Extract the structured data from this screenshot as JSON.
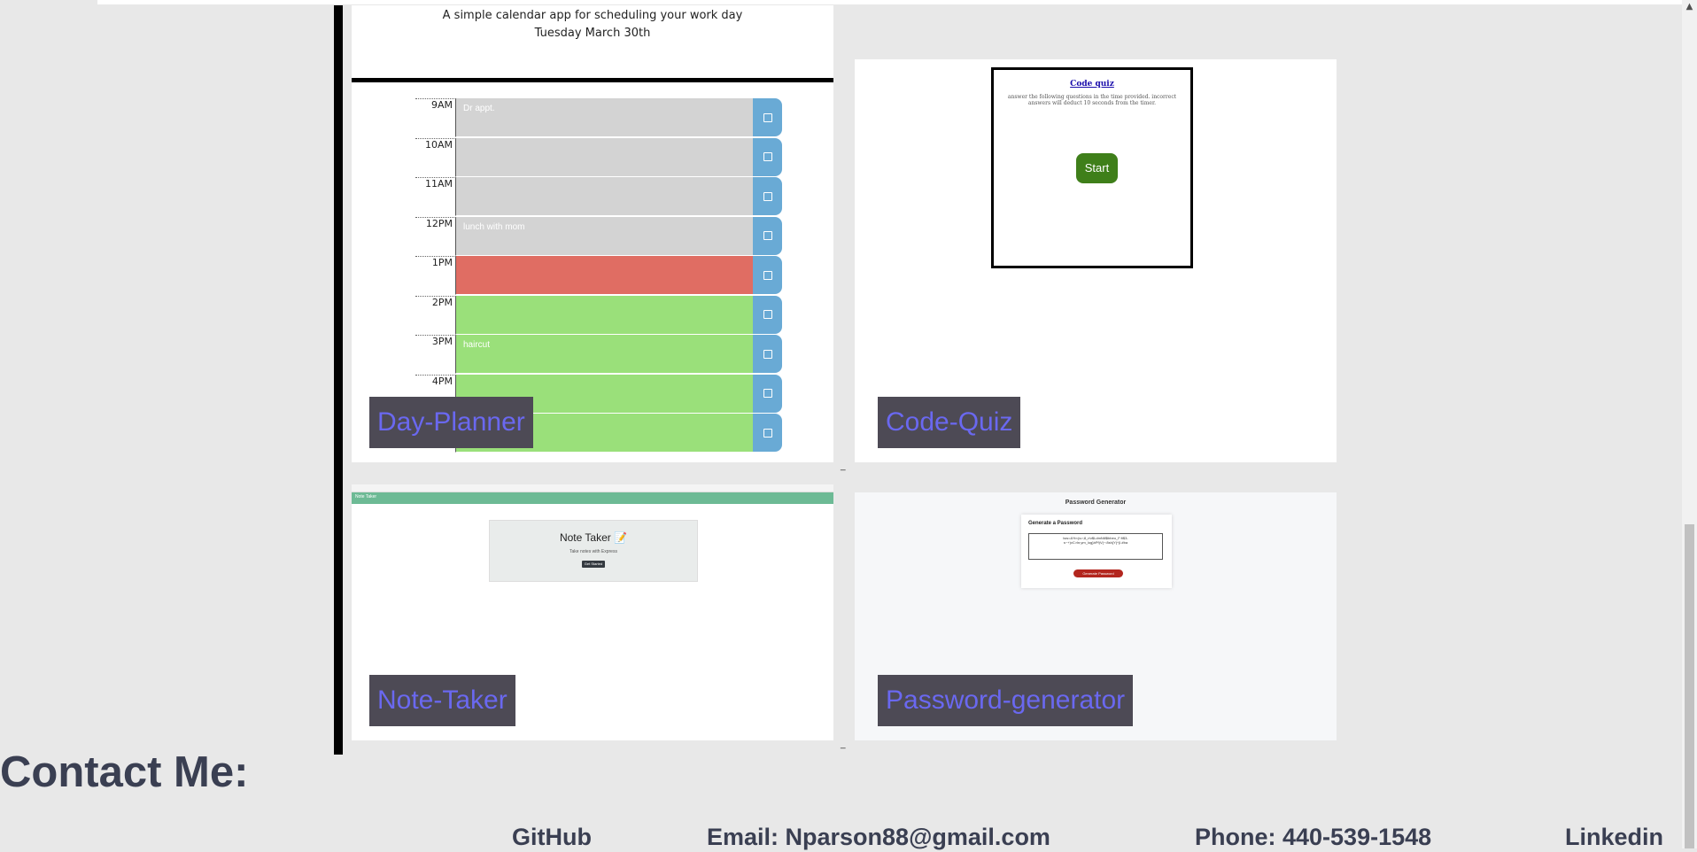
{
  "projects": [
    {
      "label": "Day-Planner",
      "preview": {
        "subtitle": "A simple calendar app for scheduling your work day",
        "date": "Tuesday March 30th",
        "rows": [
          {
            "hour": "9AM",
            "text": "Dr appt.",
            "state": "past"
          },
          {
            "hour": "10AM",
            "text": "",
            "state": "past"
          },
          {
            "hour": "11AM",
            "text": "",
            "state": "past"
          },
          {
            "hour": "12PM",
            "text": "lunch with mom",
            "state": "past"
          },
          {
            "hour": "1PM",
            "text": "",
            "state": "present"
          },
          {
            "hour": "2PM",
            "text": "",
            "state": "future"
          },
          {
            "hour": "3PM",
            "text": "haircut",
            "state": "future"
          },
          {
            "hour": "4PM",
            "text": "",
            "state": "future"
          },
          {
            "hour": "",
            "text": "",
            "state": "future"
          }
        ]
      }
    },
    {
      "label": "Code-Quiz",
      "preview": {
        "title": "Code quiz",
        "description": "answer the following questions in the time provided. incorrect answers will deduct 10 seconds from the timer.",
        "start_label": "Start"
      }
    },
    {
      "label": "Note-Taker",
      "preview": {
        "nav_text": "Note Taker",
        "title": "Note Taker 📝",
        "subtitle": "Take notes with Express",
        "button": "Get Started"
      }
    },
    {
      "label": "Password-generator",
      "preview": {
        "heading": "Password Generator",
        "card_title": "Generate a Password",
        "sample": "lsw=&%<(s>;8_n\\r$LdmN6$lbbeo_F:fi$3-s~+)vC>ln;ym_log}bPf)V(~:8sh{Y(^{i.#ba",
        "button": "Generate Password"
      }
    }
  ],
  "connector": "_",
  "contact": {
    "title": "Contact Me:",
    "links": [
      {
        "label": "GitHub"
      },
      {
        "label": "Email: Nparson88@gmail.com"
      },
      {
        "label": "Phone: 440-539-1548"
      },
      {
        "label": "Linkedin"
      }
    ]
  },
  "colors": {
    "page_background": "#e8e8e8",
    "label_background": "#4d4a55",
    "label_text": "#6a68f0",
    "past": "#d3d3d3",
    "present": "#e06d63",
    "future": "#9ae07a",
    "save_button": "#69aad5",
    "heading_text": "#3a3f52"
  },
  "icons": {
    "save": "save-icon",
    "scroll_up": "arrow-up-icon"
  }
}
